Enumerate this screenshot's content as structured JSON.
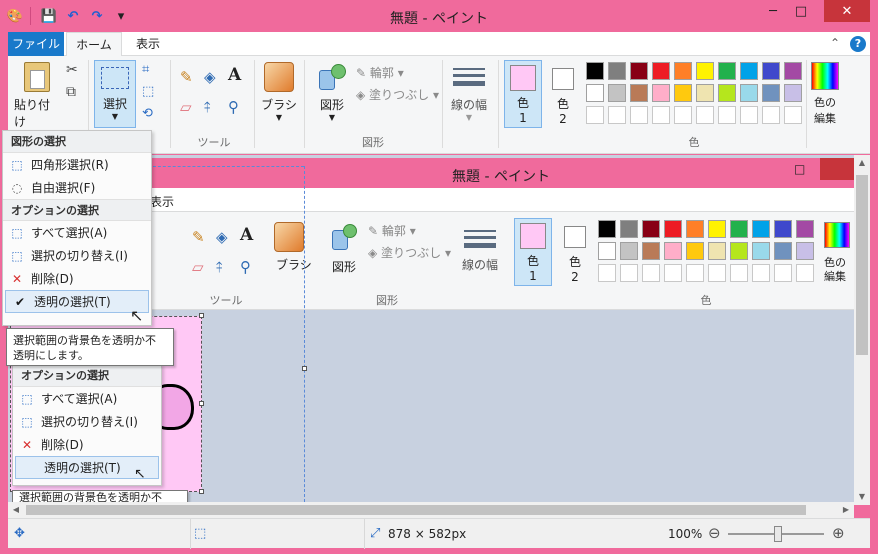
{
  "window": {
    "title": "無題 - ペイント",
    "minimize": "─",
    "maximize": "□",
    "close": "✕"
  },
  "qat": {
    "app": "🎨",
    "save": "💾",
    "undo": "↶",
    "redo": "↷",
    "more": "▾"
  },
  "tabs": {
    "file": "ファイル",
    "home": "ホーム",
    "view": "表示"
  },
  "ribbon_right": {
    "collapse": "⌃",
    "help": "?"
  },
  "clipboard": {
    "paste_label": "貼り付け",
    "cut": "✂",
    "copy": "⧉"
  },
  "image": {
    "select_label": "選択",
    "crop": "⌗",
    "resize": "⬚",
    "rotate": "⟲"
  },
  "tools": {
    "label": "ツール",
    "pencil": "✎",
    "fill": "◈",
    "text": "A",
    "eraser": "▱",
    "picker": "⤉",
    "magnifier": "⚲"
  },
  "brush": {
    "label": "ブラシ"
  },
  "shapes": {
    "label": "図形",
    "shape_label": "図形",
    "outline": "輪郭",
    "fill": "塗りつぶし"
  },
  "size": {
    "label": "線の幅"
  },
  "colors": {
    "group_label": "色",
    "color1_label": "色",
    "color1_num": "1",
    "color2_label": "色",
    "color2_num": "2",
    "edit_label": "色の",
    "edit_label2": "編集",
    "color1": "#ffc8f5",
    "color2": "#ffffff",
    "row1": [
      "#000000",
      "#7f7f7f",
      "#880015",
      "#ed1c24",
      "#ff7f27",
      "#fff200",
      "#22b14c",
      "#00a2e8",
      "#3f48cc",
      "#a349a4"
    ],
    "row2": [
      "#ffffff",
      "#c3c3c3",
      "#b97a57",
      "#ffaec9",
      "#ffc90e",
      "#efe4b0",
      "#b5e61d",
      "#99d9ea",
      "#7092be",
      "#c8bfe7"
    ]
  },
  "menu": {
    "shape_header": "図形の選択",
    "rect_select": "四角形選択(R)",
    "free_select": "自由選択(F)",
    "option_header": "オプションの選択",
    "select_all": "すべて選択(A)",
    "invert": "選択の切り替え(I)",
    "delete": "削除(D)",
    "transparent": "透明の選択(T)"
  },
  "tooltip": {
    "line1": "選択範囲の背景色を透明か不",
    "line2": "透明にします。"
  },
  "inner": {
    "title": "無題 - ペイント",
    "view_tab": "表示",
    "tools_label": "ツール",
    "brush_label": "ブラシ",
    "shape_label": "図形",
    "outline": "輪郭",
    "fill": "塗りつぶし",
    "group_label": "図形",
    "size_label": "線の幅",
    "color1_label": "色",
    "color1_num": "1",
    "color2_label": "色",
    "color2_num": "2",
    "colors_label": "色",
    "edit1": "色の",
    "edit2": "編集",
    "partial_menu": "四角形選択(R)"
  },
  "inner_menu": {
    "option_header": "オプションの選択",
    "select_all": "すべて選択(A)",
    "invert": "選択の切り替え(I)",
    "delete": "削除(D)",
    "transparent": "透明の選択(T)",
    "tooltip_partial": "選択範囲の背景色を透明か不"
  },
  "status": {
    "move_icon": "✥",
    "select_icon": "⬚",
    "size_icon": "⤢",
    "size": "878 × 582px",
    "zoom": "100%",
    "zoom_out": "⊖",
    "zoom_in": "⊕"
  }
}
